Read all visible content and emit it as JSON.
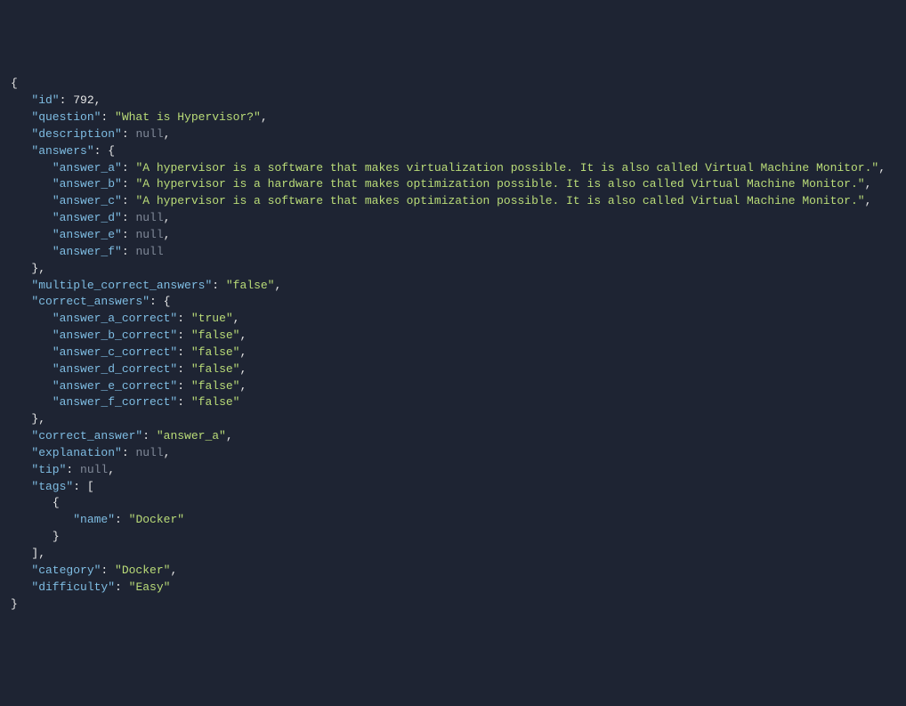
{
  "json": {
    "id": 792,
    "question": "What is Hypervisor?",
    "description": null,
    "answers": {
      "answer_a": "A hypervisor is a software that makes virtualization possible. It is also called Virtual Machine Monitor.",
      "answer_b": "A hypervisor is a hardware that makes optimization possible. It is also called Virtual Machine Monitor.",
      "answer_c": "A hypervisor is a software that makes optimization possible. It is also called Virtual Machine Monitor.",
      "answer_d": null,
      "answer_e": null,
      "answer_f": null
    },
    "multiple_correct_answers": "false",
    "correct_answers": {
      "answer_a_correct": "true",
      "answer_b_correct": "false",
      "answer_c_correct": "false",
      "answer_d_correct": "false",
      "answer_e_correct": "false",
      "answer_f_correct": "false"
    },
    "correct_answer": "answer_a",
    "explanation": null,
    "tip": null,
    "tags": [
      {
        "name": "Docker"
      }
    ],
    "category": "Docker",
    "difficulty": "Easy"
  }
}
